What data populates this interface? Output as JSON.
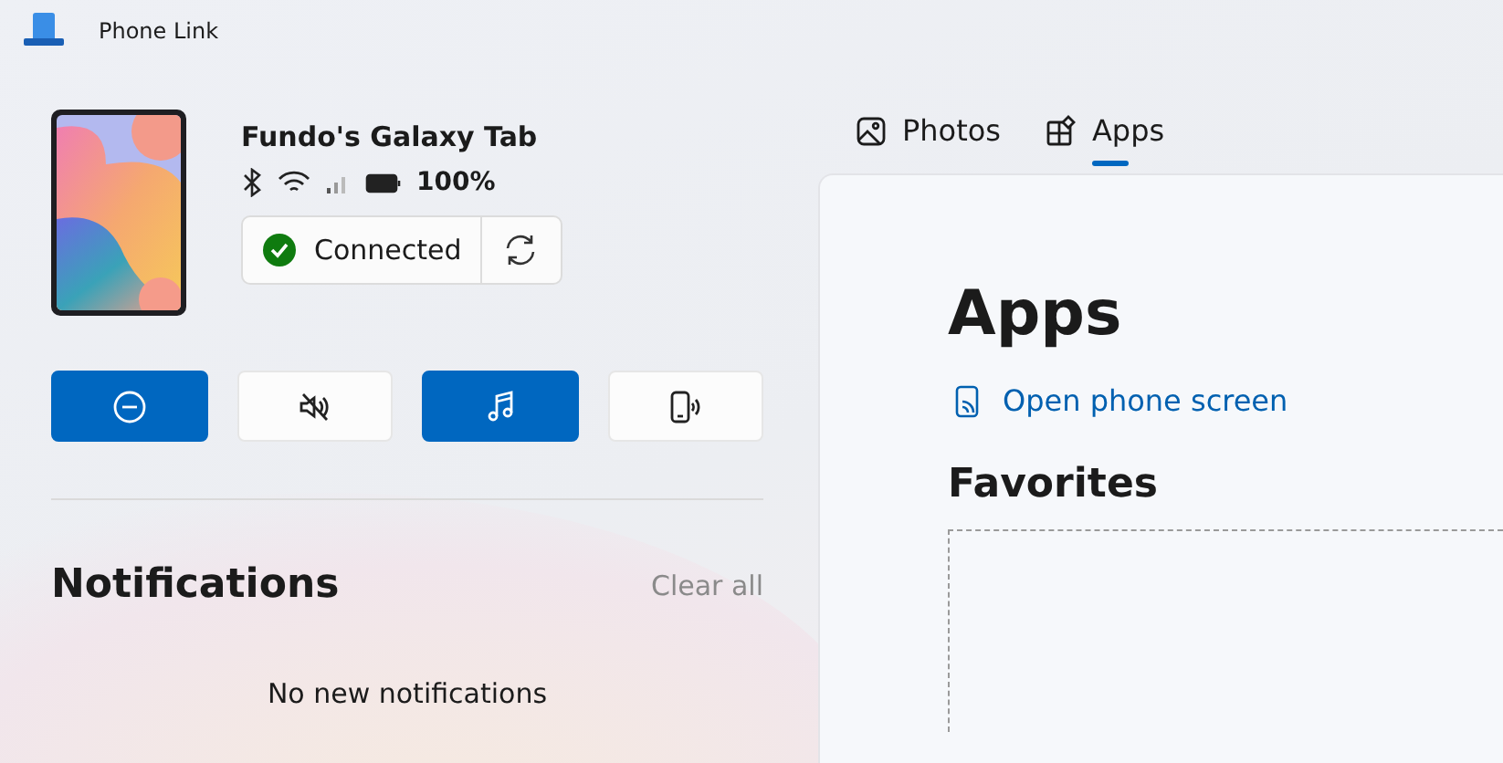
{
  "window": {
    "title": "Phone Link"
  },
  "device": {
    "name": "Fundo's Galaxy Tab",
    "battery": "100%",
    "status": "Connected",
    "connected": true
  },
  "quick_actions": [
    {
      "kind": "do-not-disturb",
      "on": true
    },
    {
      "kind": "mute",
      "on": false
    },
    {
      "kind": "media",
      "on": true
    },
    {
      "kind": "ring",
      "on": false
    }
  ],
  "notifications": {
    "title": "Notifications",
    "clear": "Clear all",
    "empty": "No new notifications"
  },
  "tabs": [
    {
      "label": "Photos",
      "kind": "photos",
      "selected": false
    },
    {
      "label": "Apps",
      "kind": "apps",
      "selected": true
    }
  ],
  "apps": {
    "title": "Apps",
    "open_link": "Open phone screen",
    "favorites": "Favorites"
  }
}
